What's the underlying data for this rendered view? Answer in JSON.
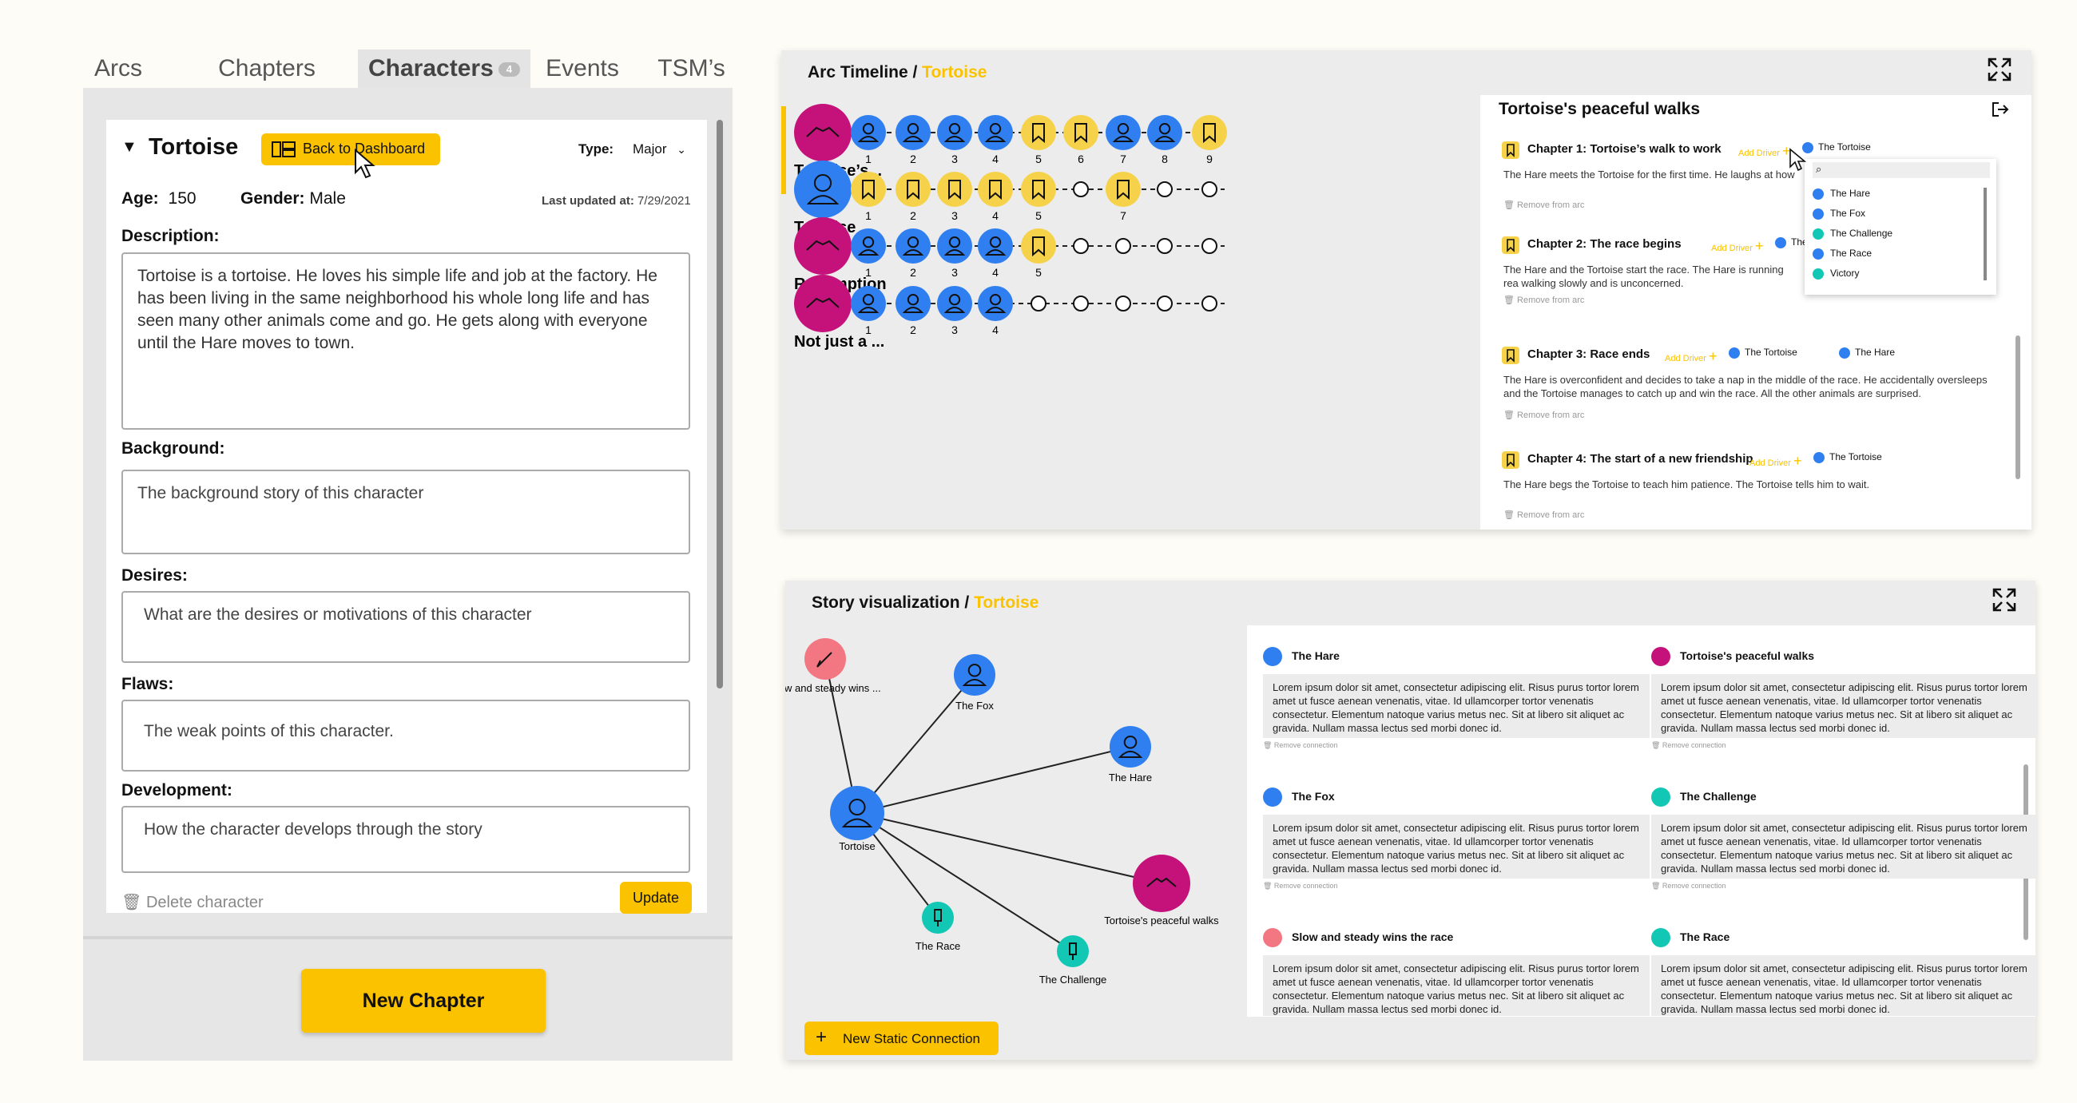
{
  "left": {
    "tabs": [
      {
        "label": "Arcs"
      },
      {
        "label": "Chapters"
      },
      {
        "label": "Characters",
        "badge": "4"
      },
      {
        "label": "Events"
      },
      {
        "label": "TSM’s"
      }
    ],
    "character": {
      "name": "Tortoise",
      "back_button": "Back to Dashboard",
      "type_label": "Type:",
      "type_value": "Major",
      "age_label": "Age:",
      "age_value": "150",
      "gender_label": "Gender:",
      "gender_value": "Male",
      "updated_label": "Last updated at:",
      "updated_value": "7/29/2021",
      "description_label": "Description:",
      "description_value": "Tortoise is a tortoise. He loves his simple life and job at the factory. He has been living in the same neighborhood his whole long life and has seen many other animals come and go. He gets along with everyone until the Hare moves to town.",
      "background_label": "Background:",
      "background_placeholder": "The background story of this character",
      "desires_label": "Desires:",
      "desires_placeholder": "What are the desires or motivations of this character",
      "flaws_label": "Flaws:",
      "flaws_placeholder": "The weak points of this character.",
      "development_label": "Development:",
      "development_placeholder": "How the character develops through the story",
      "delete_label": "Delete character",
      "update_label": "Update"
    },
    "new_chapter": "New Chapter"
  },
  "arc_timeline": {
    "title": "Arc Timeline / ",
    "title_accent": "Tortoise",
    "rows": [
      {
        "label": "Tortoise’s ..",
        "icon": "arc-icon",
        "nums": [
          "1",
          "2",
          "3",
          "4",
          "5",
          "6",
          "7",
          "8",
          "9"
        ]
      },
      {
        "label": "Tortoise",
        "icon": "person-icon",
        "nums": [
          "1",
          "2",
          "3",
          "4",
          "5",
          "7"
        ]
      },
      {
        "label": "Redemption",
        "icon": "arc-icon",
        "nums": [
          "1",
          "2",
          "3",
          "4",
          "5"
        ]
      },
      {
        "label": "Not just a ...",
        "icon": "arc-icon",
        "nums": [
          "1",
          "2",
          "3",
          "4"
        ]
      }
    ],
    "detail": {
      "title": "Tortoise's peaceful walks",
      "add_driver": "Add Driver",
      "remove": "Remove from arc",
      "chapters": [
        {
          "title": "Chapter 1: Tortoise’s walk to work",
          "tag": "The Tortoise",
          "text": "The Hare meets the Tortoise for the first time. He laughs at how"
        },
        {
          "title": "Chapter 2: The race begins",
          "tag": "The",
          "text": "The Hare and the Tortoise start the race. The Hare is running rea walking slowly and is unconcerned."
        },
        {
          "title": "Chapter 3: Race ends",
          "tag": "The Tortoise",
          "tag2": "The Hare",
          "text": "The Hare is overconfident and decides to take a nap in the middle of the race. He accidentally oversleeps and the Tortoise manages to catch up and win the race. All the other animals are surprised."
        },
        {
          "title": "Chapter 4: The start of a new friendship",
          "tag": "The Tortoise",
          "text": "The Hare begs the Tortoise to teach him patience. The Tortoise tells him to wait."
        }
      ],
      "dropdown": [
        "The Hare",
        "The Fox",
        "The Challenge",
        "The Race",
        "Victory"
      ]
    }
  },
  "story_viz": {
    "title": "Story visualization / ",
    "title_accent": "Tortoise",
    "graph_labels": {
      "slow": "Slow and steady wins ...",
      "fox": "The Fox",
      "hare": "The Hare",
      "tortoise": "Tortoise",
      "walks": "Tortoise's peaceful walks",
      "race": "The Race",
      "challenge": "The Challenge"
    },
    "connections": [
      {
        "title": "The Hare",
        "color": "#2f7ff0"
      },
      {
        "title": "Tortoise's peaceful walks",
        "color": "#c4127a"
      },
      {
        "title": "The Fox",
        "color": "#2f7ff0"
      },
      {
        "title": "The Challenge",
        "color": "#12c7b4"
      },
      {
        "title": "Slow and steady wins the race",
        "color": "#f27782"
      },
      {
        "title": "The Race",
        "color": "#12c7b4"
      }
    ],
    "lorem": "Lorem ipsum dolor sit amet, consectetur adipiscing elit. Risus purus tortor lorem amet ut fusce aenean venenatis, vitae. Id ullamcorper tortor venenatis consectetur. Elementum natoque varius metus nec. Sit at libero sit aliquet ac gravida. Nullam massa lectus sed morbi donec id.",
    "remove_connection": "Remove connection",
    "new_connection": "New Static Connection"
  },
  "colors": {
    "accent": "#fbc200",
    "blue": "#2f7ff0",
    "magenta": "#c4127a",
    "teal": "#12c7b4",
    "coral": "#f27782"
  }
}
